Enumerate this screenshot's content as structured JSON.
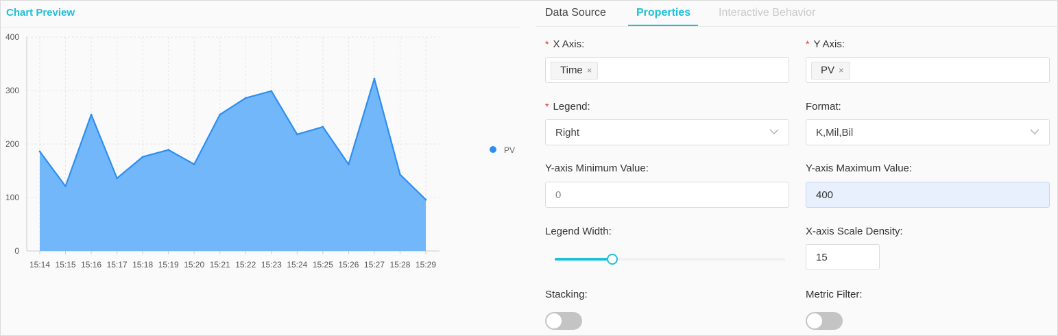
{
  "preview": {
    "title": "Chart Preview"
  },
  "chart_data": {
    "type": "area",
    "categories": [
      "15:14",
      "15:15",
      "15:16",
      "15:17",
      "15:18",
      "15:19",
      "15:20",
      "15:21",
      "15:22",
      "15:23",
      "15:24",
      "15:25",
      "15:26",
      "15:27",
      "15:28",
      "15:29"
    ],
    "series": [
      {
        "name": "PV",
        "values": [
          186,
          121,
          255,
          136,
          176,
          189,
          162,
          255,
          286,
          299,
          218,
          232,
          162,
          322,
          143,
          96
        ],
        "color": "#2d8ef2"
      }
    ],
    "yticks": [
      "0",
      "100",
      "200",
      "300",
      "400"
    ],
    "ylim": [
      0,
      400
    ],
    "grid": true,
    "legend": "right",
    "fill_color": "#72b7fa"
  },
  "tabs": [
    {
      "label": "Data Source",
      "state": "normal"
    },
    {
      "label": "Properties",
      "state": "active"
    },
    {
      "label": "Interactive Behavior",
      "state": "disabled"
    }
  ],
  "form": {
    "x_axis": {
      "label": "X Axis:",
      "tag": "Time"
    },
    "y_axis": {
      "label": "Y Axis:",
      "tag": "PV"
    },
    "legend": {
      "label": "Legend:",
      "value": "Right"
    },
    "format": {
      "label": "Format:",
      "value": "K,Mil,Bil"
    },
    "ymin": {
      "label": "Y-axis Minimum Value:",
      "value": "0"
    },
    "ymax": {
      "label": "Y-axis Maximum Value:",
      "value": "400"
    },
    "legend_width": {
      "label": "Legend Width:",
      "fraction": 0.25
    },
    "xdensity": {
      "label": "X-axis Scale Density:",
      "value": "15"
    },
    "stacking": {
      "label": "Stacking:",
      "on": false
    },
    "metric_filter": {
      "label": "Metric Filter:",
      "on": false
    }
  },
  "icons": {
    "required": "*",
    "remove": "×"
  },
  "colors": {
    "accent": "#1ec0d9",
    "required": "#e0332c"
  }
}
